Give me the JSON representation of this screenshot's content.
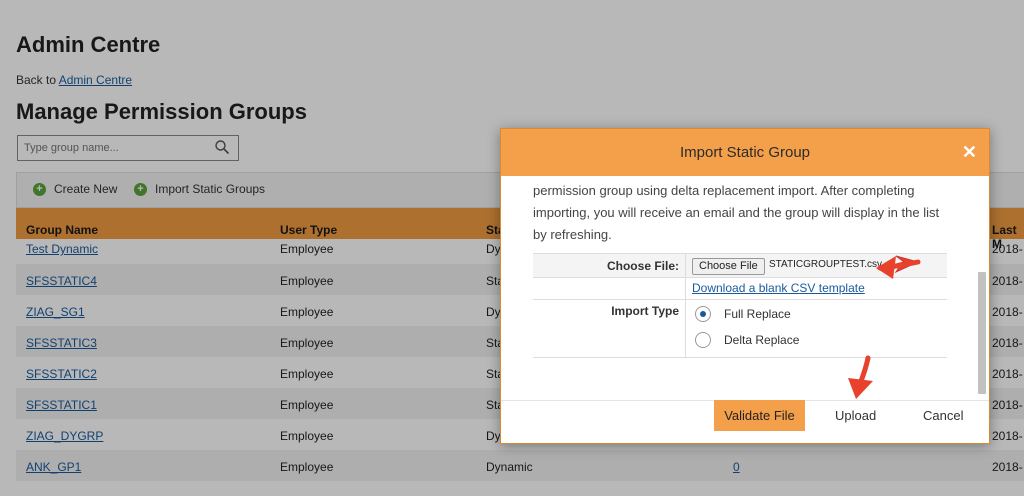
{
  "page": {
    "heading": "Admin Centre",
    "back_prefix": "Back to",
    "back_link": "Admin Centre",
    "title": "Manage Permission Groups",
    "search_placeholder": "Type group name..."
  },
  "toolbar": {
    "create_new": "Create New",
    "import_static": "Import Static Groups"
  },
  "table": {
    "columns": [
      "Group Name",
      "User Type",
      "Sta",
      "Last M"
    ],
    "rows": [
      {
        "name": "Test Dynamic",
        "user_type": "Employee",
        "status": "Dy",
        "count": "",
        "date": "2018-"
      },
      {
        "name": "SFSSTATIC4",
        "user_type": "Employee",
        "status": "Sta",
        "count": "",
        "date": "2018-"
      },
      {
        "name": "ZIAG_SG1",
        "user_type": "Employee",
        "status": "Dy",
        "count": "",
        "date": "2018-"
      },
      {
        "name": "SFSSTATIC3",
        "user_type": "Employee",
        "status": "Sta",
        "count": "",
        "date": "2018-"
      },
      {
        "name": "SFSSTATIC2",
        "user_type": "Employee",
        "status": "Sta",
        "count": "",
        "date": "2018-"
      },
      {
        "name": "SFSSTATIC1",
        "user_type": "Employee",
        "status": "Sta",
        "count": "",
        "date": "2018-"
      },
      {
        "name": "ZIAG_DYGRP",
        "user_type": "Employee",
        "status": "Dy",
        "count": "",
        "date": "2018-"
      },
      {
        "name": "ANK_GP1",
        "user_type": "Employee",
        "status": "Dynamic",
        "count": "0",
        "date": "2018-"
      }
    ]
  },
  "dialog": {
    "title": "Import Static Group",
    "close_symbol": "✕",
    "description": "permission group using delta replacement import. After completing importing, you will receive an email and the group will display in the list by refreshing.",
    "choose_file_label": "Choose File:",
    "choose_file_button": "Choose File",
    "file_name": "STATICGROUPTEST.csv",
    "template_link": "Download a blank CSV template",
    "import_type_label": "Import Type",
    "options": [
      {
        "label": "Full Replace",
        "selected": true
      },
      {
        "label": "Delta Replace",
        "selected": false
      }
    ],
    "validate": "Validate File",
    "upload": "Upload",
    "cancel": "Cancel"
  },
  "colors": {
    "accent": "#f4a04a",
    "link": "#1a5a9c",
    "annotation_arrow": "#e8412c"
  }
}
